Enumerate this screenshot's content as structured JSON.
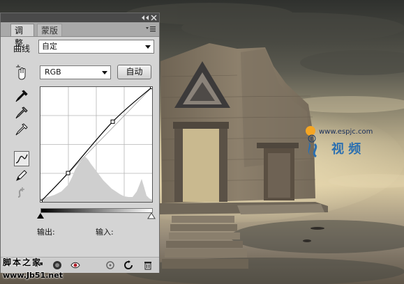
{
  "panel": {
    "tabs": [
      {
        "label": "调整"
      },
      {
        "label": "蒙版"
      }
    ],
    "preset_label": "曲线",
    "preset_value": "自定",
    "channel_value": "RGB",
    "auto_button": "自动",
    "output_label": "输出:",
    "input_label": "输入:"
  },
  "curve": {
    "points": [
      [
        0,
        0
      ],
      [
        63,
        64
      ],
      [
        165,
        178
      ],
      [
        255,
        255
      ]
    ]
  },
  "watermark": {
    "url": "www.espjc.com",
    "chinese": "视 频",
    "letter": "E",
    "bottom_text": "脚本之家",
    "bottom_url": "www.Jb51.net"
  },
  "colors": {
    "sky_top": "#3d3f3a",
    "sky_mid": "#8e8b78",
    "sky_warm": "#d9c9a1",
    "panel_bg": "#d4d4d4",
    "logo_blue": "#2b6fb0",
    "logo_orange": "#f5a623"
  }
}
